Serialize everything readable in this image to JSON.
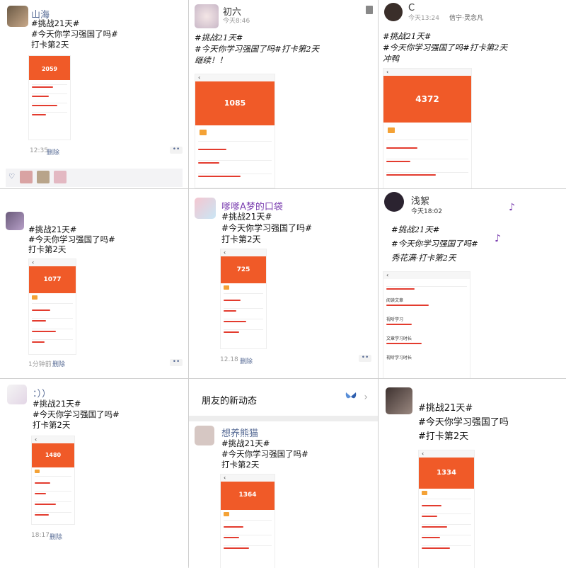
{
  "posts": [
    {
      "name": "山海",
      "lines": [
        "#挑战21天#",
        "#今天你学习强国了吗#",
        "打卡第2天"
      ],
      "score": "2059",
      "time": "12:35",
      "delete": "删除"
    },
    {
      "name": "初六",
      "sub": "今天8:46",
      "lines": [
        "#挑战21天#",
        "#今天你学习强国了吗#打卡第2天",
        "继续！！"
      ],
      "score": "1085"
    },
    {
      "name": "C",
      "sub": "今天13:24",
      "tag": "信宁·灵念凡",
      "lines": [
        "#挑战21天#",
        "#今天你学习强国了吗#打卡第2天",
        "冲鸭"
      ],
      "score": "4372"
    },
    {
      "name": "",
      "lines": [
        "#挑战21天#",
        "#今天你学习强国了吗#",
        "打卡第2天"
      ],
      "score": "1077",
      "time": "1分钟前",
      "delete": "删除"
    },
    {
      "name": "嗲嗲A梦的口袋",
      "lines": [
        "#挑战21天#",
        "#今天你学习强国了吗#",
        "打卡第2天"
      ],
      "score": "725",
      "time": "12.18",
      "delete": "删除"
    },
    {
      "name": "浅絮",
      "sub": "今天18:02",
      "lines": [
        "#挑战21天#",
        "#今天你学习强国了吗#",
        "秀花满·打卡第2天"
      ],
      "rows": [
        "阅读文章",
        "视听学习",
        "文章学习时长",
        "视听学习时长"
      ]
    },
    {
      "name": "：））",
      "lines": [
        "#挑战21天#",
        "#今天你学习强国了吗#",
        "打卡第2天"
      ],
      "score": "1480",
      "time": "18:17",
      "delete": "删除"
    },
    {
      "header": "朋友的新动态",
      "name": "想养熊猫",
      "lines": [
        "#挑战21天#",
        "#今天你学习强国了吗#",
        "打卡第2天"
      ],
      "score": "1364"
    },
    {
      "name": "",
      "lines": [
        "#挑战21天#",
        "#今天你学习强国了吗",
        "#打卡第2天"
      ],
      "score": "1334"
    }
  ]
}
